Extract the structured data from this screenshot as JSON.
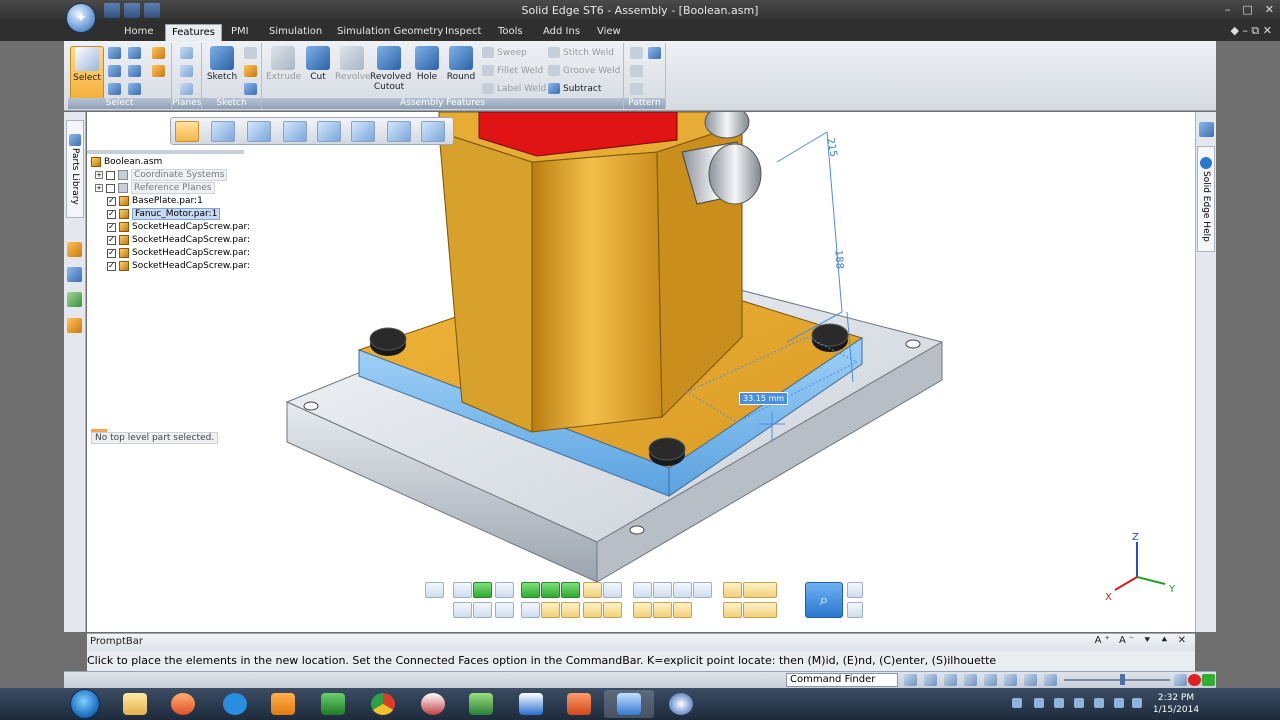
{
  "window": {
    "title": "Solid Edge ST6 - Assembly - [Boolean.asm]",
    "controls": [
      "–",
      "□",
      "✕"
    ],
    "inner_controls": [
      "–",
      "⧉",
      "✕"
    ]
  },
  "tabs": [
    "Home",
    "Features",
    "PMI",
    "Simulation",
    "Simulation Geometry",
    "Inspect",
    "Tools",
    "Add Ins",
    "View"
  ],
  "active_tab": "Features",
  "ribbon": {
    "groups": [
      "Select",
      "Planes",
      "Sketch",
      "Assembly Features",
      "Pattern"
    ],
    "select_label": "Select",
    "sketch_label": "Sketch",
    "features": [
      "Extrude",
      "Cut",
      "Revolve",
      "Revolved Cutout",
      "Hole",
      "Round"
    ],
    "small_features": [
      "Sweep",
      "Fillet Weld",
      "Label Weld",
      "Stitch Weld",
      "Groove Weld",
      "Subtract"
    ]
  },
  "left_tabs": {
    "parts_library": "Parts Library"
  },
  "right_tabs": {
    "help": "Solid Edge Help"
  },
  "tree": {
    "root": "Boolean.asm",
    "items": [
      {
        "label": "Coordinate Systems",
        "expand": "+",
        "checked": false,
        "dim": true
      },
      {
        "label": "Reference Planes",
        "expand": "+",
        "checked": false,
        "dim": true
      },
      {
        "label": "BasePlate.par:1",
        "expand": "",
        "checked": true,
        "dim": false
      },
      {
        "label": "Fanuc_Motor.par:1",
        "expand": "",
        "checked": true,
        "selected": true
      },
      {
        "label": "SocketHeadCapScrew.par:",
        "expand": "",
        "checked": true,
        "dim": false
      },
      {
        "label": "SocketHeadCapScrew.par:",
        "expand": "",
        "checked": true,
        "dim": false
      },
      {
        "label": "SocketHeadCapScrew.par:",
        "expand": "",
        "checked": true,
        "dim": false
      },
      {
        "label": "SocketHeadCapScrew.par:",
        "expand": "",
        "checked": true,
        "dim": false
      }
    ],
    "status_message": "No top level part selected."
  },
  "viewport": {
    "dimension_values": [
      "215",
      "188"
    ],
    "live_dimension": "33.15 mm",
    "triad": {
      "x": "X",
      "y": "Y",
      "z": "Z"
    }
  },
  "promptbar": {
    "title": "PromptBar",
    "controls": "A⁺ A⁻ ⯆ ⯅ ✕",
    "text": "Click to place the elements in the new location.  Set the Connected Faces option in the CommandBar.  K=explicit point locate: then (M)id, (E)nd, (C)enter, (S)ilhouette"
  },
  "statusbar": {
    "command_finder": "Command Finder"
  },
  "taskbar": {
    "time": "2:32 PM",
    "date": "1/15/2014"
  },
  "colors": {
    "accent": "#2b78cf",
    "part_gold": "#e8b23a",
    "motor_red": "#e01414",
    "plate": "#c9d0d8",
    "highlight": "#7fb6ec"
  }
}
